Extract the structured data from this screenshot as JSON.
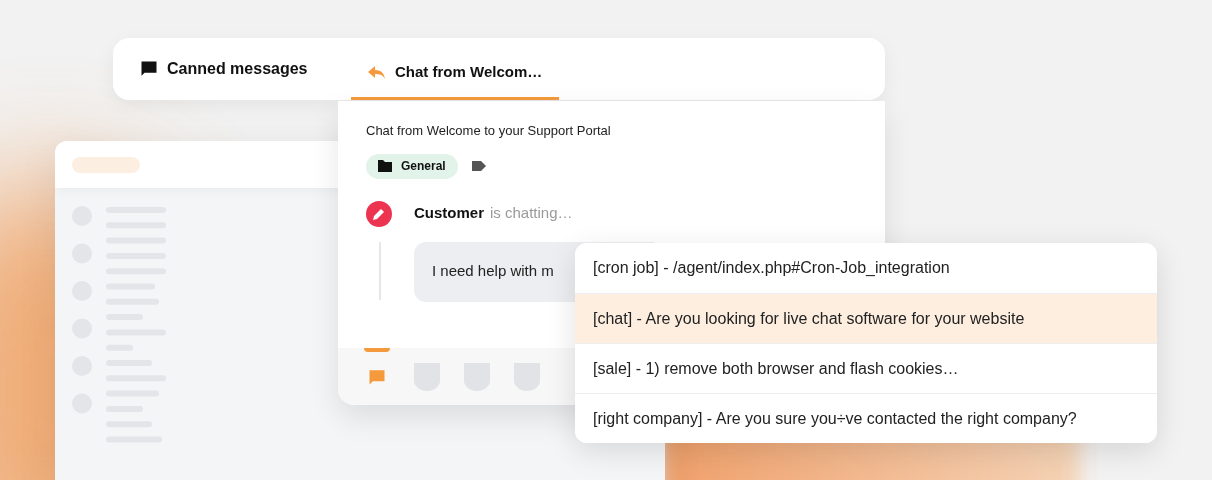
{
  "header": {
    "title": "Canned messages"
  },
  "tabs": [
    {
      "label": "Chat from Welcom…",
      "selected": true
    }
  ],
  "chat": {
    "subject": "Chat from Welcome to your Support Portal",
    "tag": "General",
    "author": "Customer",
    "status": "is chatting…",
    "message": "I need help with m"
  },
  "toolbar": [
    {
      "kind": "chat",
      "selected": true
    },
    {
      "kind": "blank",
      "selected": false
    },
    {
      "kind": "blank",
      "selected": false
    },
    {
      "kind": "blank",
      "selected": false
    }
  ],
  "suggestions": [
    {
      "text": "[cron job] - /agent/index.php#Cron-Job_integration",
      "selected": false
    },
    {
      "text": "[chat] - Are you looking for live chat software for your website",
      "selected": true
    },
    {
      "text": "[sale] - 1) remove both browser and flash cookies…",
      "selected": false
    },
    {
      "text": "[right company] - Are you sure you÷ve contacted the right company?",
      "selected": false
    }
  ]
}
